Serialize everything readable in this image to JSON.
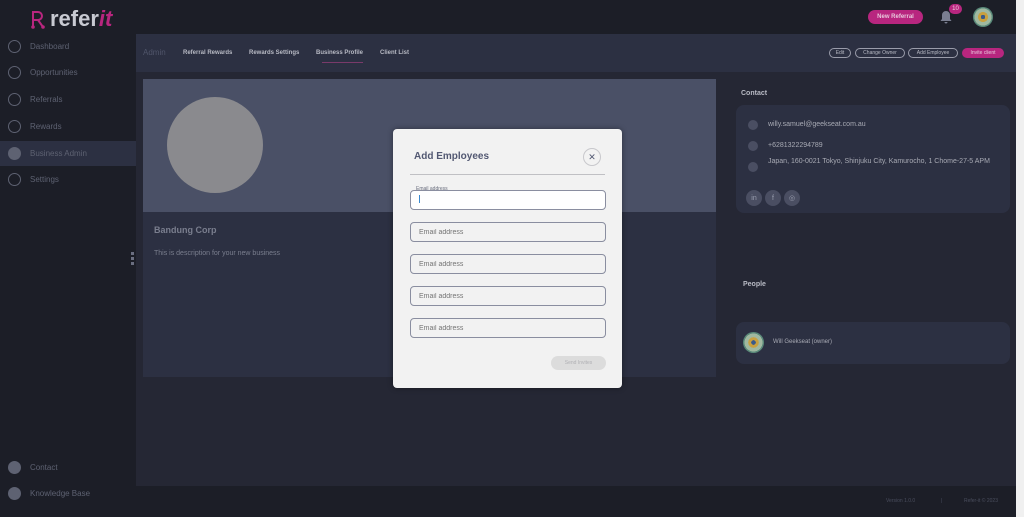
{
  "app": {
    "logo_text": "refer",
    "logo_accent": "it"
  },
  "topbar": {
    "new_referral": "New Referral",
    "notifications_count": "10"
  },
  "sidebar": {
    "items": [
      {
        "label": "Dashboard",
        "icon": "dashboard-icon"
      },
      {
        "label": "Opportunities",
        "icon": "lightbulb-icon"
      },
      {
        "label": "Referrals",
        "icon": "referrals-icon"
      },
      {
        "label": "Rewards",
        "icon": "rewards-icon"
      },
      {
        "label": "Business Admin",
        "icon": "business-admin-icon",
        "active": true
      },
      {
        "label": "Settings",
        "icon": "gear-icon"
      }
    ],
    "bottom": [
      {
        "label": "Contact",
        "icon": "help-icon"
      },
      {
        "label": "Knowledge Base",
        "icon": "info-icon"
      }
    ]
  },
  "tabs": {
    "section": "Admin",
    "items": [
      "Referral Rewards",
      "Rewards Settings",
      "Business Profile",
      "Client List"
    ],
    "selected": "Business Profile"
  },
  "actions": {
    "edit": "Edit",
    "change_owner": "Change Owner",
    "add_employee": "Add Employee",
    "invite_client": "Invite client"
  },
  "profile": {
    "name": "Bandung Corp",
    "description": "This is description for your new business"
  },
  "contact": {
    "title": "Contact",
    "email": "willy.samuel@geekseat.com.au",
    "phone": "+6281322294789",
    "address": "Japan, 160-0021 Tokyo, Shinjuku City, Kamurocho, 1 Chome-27-5 APM",
    "socials": [
      "linkedin-icon",
      "facebook-icon",
      "instagram-icon"
    ]
  },
  "people": {
    "title": "People",
    "members": [
      {
        "name": "Will Geekseat (owner)"
      }
    ]
  },
  "footer": {
    "version": "Version 1.0.0",
    "separator": "|",
    "copyright": "Refer-it © 2023"
  },
  "modal": {
    "title": "Add Employees",
    "field_label": "Email address",
    "placeholder": "Email address",
    "fields": [
      "",
      "",
      "",
      "",
      ""
    ],
    "send": "Send Invites"
  },
  "colors": {
    "accent": "#b8267f",
    "background": "#1c1e27",
    "panel": "#2c3042"
  }
}
